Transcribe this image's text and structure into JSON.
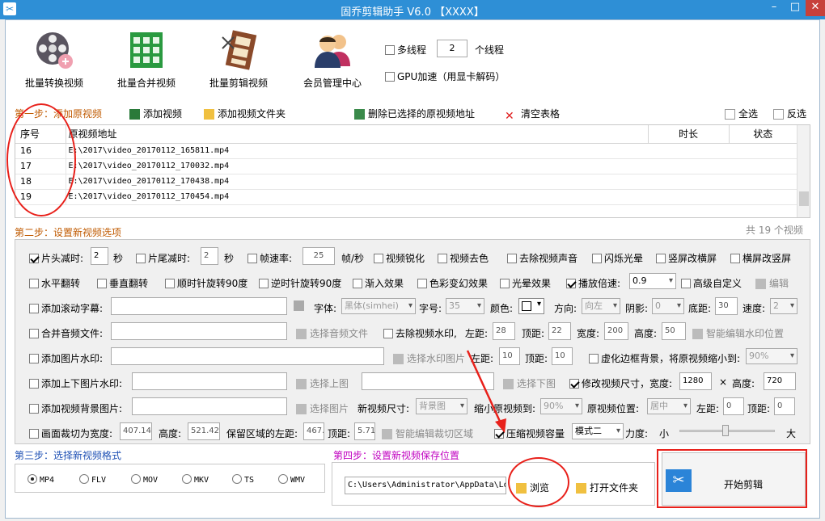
{
  "window": {
    "title": "固乔剪辑助手 V6.0 【XXXX】"
  },
  "toolbar": {
    "buttons": [
      {
        "label": "批量转换视频"
      },
      {
        "label": "批量合并视频"
      },
      {
        "label": "批量剪辑视频"
      },
      {
        "label": "会员管理中心"
      }
    ],
    "multithread_label": "多线程",
    "thread_count": "2",
    "thread_suffix": "个线程",
    "gpu_label": "GPU加速（用显卡解码）"
  },
  "step1": {
    "label": "第一步：添加原视频",
    "add_video": "添加视频",
    "add_folder": "添加视频文件夹",
    "delete_selected": "删除已选择的原视频地址",
    "clear_table": "清空表格",
    "select_all": "全选",
    "invert": "反选"
  },
  "table": {
    "headers": [
      "序号",
      "原视频地址",
      "时长",
      "状态"
    ],
    "rows": [
      {
        "no": "16",
        "path": "E:\\2017\\video_20170112_165811.mp4"
      },
      {
        "no": "17",
        "path": "E:\\2017\\video_20170112_170032.mp4"
      },
      {
        "no": "18",
        "path": "E:\\2017\\video_20170112_170438.mp4"
      },
      {
        "no": "19",
        "path": "E:\\2017\\video_20170112_170454.mp4"
      }
    ],
    "total": "共 19 个视频"
  },
  "step2": {
    "label": "第二步：设置新视频选项",
    "r1": {
      "head_cut": "片头减时:",
      "head_val": "2",
      "sec1": "秒",
      "tail_cut": "片尾减时:",
      "tail_val": "2",
      "sec2": "秒",
      "fps": "帧速率:",
      "fps_val": "25",
      "fps_unit": "帧/秒",
      "sharpen": "视频锐化",
      "decolor": "视频去色",
      "mute": "去除视频声音",
      "flash": "闪烁光晕",
      "v2h": "竖屏改横屏",
      "h2v": "横屏改竖屏"
    },
    "r2": {
      "hflip": "水平翻转",
      "vflip": "垂直翻转",
      "cw90": "顺时针旋转90度",
      "ccw90": "逆时针旋转90度",
      "fadein": "渐入效果",
      "color": "色彩变幻效果",
      "halo": "光晕效果",
      "speed": "播放倍速:",
      "speed_val": "0.9",
      "custom": "高级自定义",
      "edit": "编辑"
    },
    "r3": {
      "subtitle": "添加滚动字幕:",
      "font": "字体:",
      "font_val": "黑体(simhei)",
      "size": "字号:",
      "size_val": "35",
      "color": "颜色:",
      "direction": "方向:",
      "dir_val": "向左",
      "shadow": "阴影:",
      "shadow_val": "0",
      "bottom": "底距:",
      "bottom_val": "30",
      "speed": "速度:",
      "speed_val": "2"
    },
    "r4": {
      "merge_audio": "合并音频文件:",
      "choose_audio": "选择音频文件",
      "remove_wm": "去除视频水印,",
      "left": "左距:",
      "left_val": "28",
      "top": "顶距:",
      "top_val": "22",
      "width": "宽度:",
      "width_val": "200",
      "height": "高度:",
      "height_val": "50",
      "smart_wm": "智能编辑水印位置"
    },
    "r5": {
      "img_wm": "添加图片水印:",
      "choose_wm": "选择水印图片",
      "left": "左距:",
      "left_val": "10",
      "top": "顶距:",
      "top_val": "10",
      "blur": "虚化边框背景，将原视频缩小到:",
      "blur_val": "90%"
    },
    "r6": {
      "topbottom": "添加上下图片水印:",
      "choose_top": "选择上图",
      "choose_bottom": "选择下图",
      "resize": "修改视频尺寸，宽度:",
      "w_val": "1280",
      "times": "×",
      "height": "高度:",
      "h_val": "720"
    },
    "r7": {
      "bg": "添加视频背景图片:",
      "choose_img": "选择图片",
      "new_size": "新视频尺寸:",
      "size_val": "背景图",
      "shrink": "缩小原视频到:",
      "shrink_val": "90%",
      "pos": "原视频位置:",
      "pos_val": "居中",
      "left": "左距:",
      "left_val": "0",
      "top": "顶距:",
      "top_val": "0"
    },
    "r8": {
      "crop": "画面裁切为宽度:",
      "crop_w": "407.142",
      "height": "高度:",
      "crop_h": "521.428",
      "keep_left": "保留区域的左距:",
      "left_val": "467.",
      "top": "顶距:",
      "top_val": "5.71",
      "smart_crop": "智能编辑裁切区域",
      "compress": "压缩视频容量",
      "mode_val": "模式二",
      "strength": "力度:",
      "small": "小",
      "large": "大"
    }
  },
  "step3": {
    "label": "第三步：选择新视频格式",
    "formats": [
      "MP4",
      "FLV",
      "MOV",
      "MKV",
      "TS",
      "WMV"
    ]
  },
  "step4": {
    "label": "第四步：设置新视频保存位置",
    "path": "C:\\Users\\Administrator\\AppData\\Lo",
    "browse": "浏览",
    "open_folder": "打开文件夹",
    "start": "开始剪辑"
  },
  "colors": {
    "titlebar": "#2e8fd6",
    "annotation": "#e8201a",
    "step_orange": "#c05a00",
    "step_blue": "#1e50b4",
    "step_magenta": "#c000c0"
  }
}
